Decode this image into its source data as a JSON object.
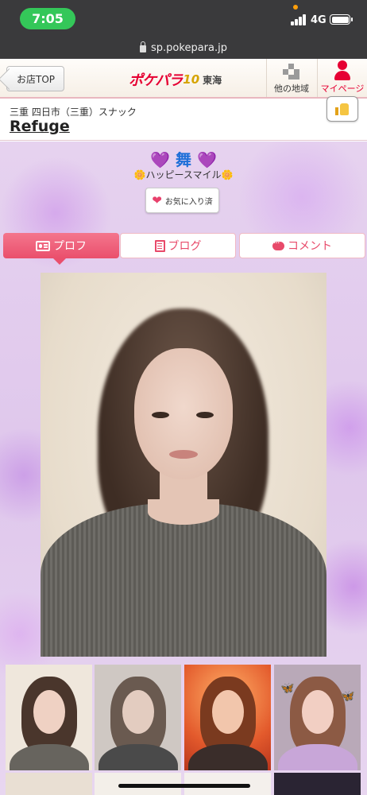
{
  "status_bar": {
    "time": "7:05",
    "network": "4G"
  },
  "browser": {
    "url": "sp.pokepara.jp"
  },
  "header": {
    "back_label": "お店TOP",
    "logo_main": "ポケパラ",
    "logo_10": "10",
    "logo_region": "東海",
    "other_region_label": "他の地域",
    "mypage_label": "マイページ"
  },
  "shop": {
    "category": "三重 四日市（三重）スナック",
    "name": "Refuge"
  },
  "cast": {
    "name": "舞",
    "name_decor": "💜",
    "catchphrase": "ハッピースマイル",
    "catch_decor": "🌼",
    "favorite_label": "お気に入り済"
  },
  "tabs": [
    {
      "label": "プロフ",
      "active": true
    },
    {
      "label": "ブログ",
      "active": false
    },
    {
      "label": "コメント",
      "active": false
    }
  ],
  "colors": {
    "accent": "#ea4f6c",
    "brand_red": "#e60033",
    "name_blue": "#1f6fd8"
  },
  "icons": [
    "lock-icon",
    "map-icon",
    "person-icon",
    "thumbs-up-icon",
    "heart-icon",
    "profile-card-icon",
    "blog-icon",
    "comment-icon"
  ]
}
